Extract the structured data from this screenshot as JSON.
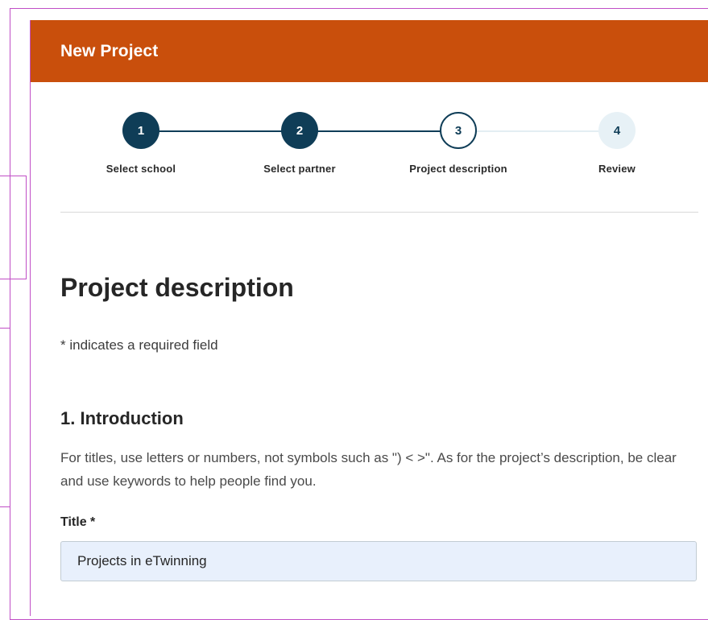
{
  "header": {
    "title": "New Project"
  },
  "stepper": {
    "steps": [
      {
        "number": "1",
        "label": "Select school",
        "state": "done"
      },
      {
        "number": "2",
        "label": "Select partner",
        "state": "done"
      },
      {
        "number": "3",
        "label": "Project description",
        "state": "current"
      },
      {
        "number": "4",
        "label": "Review",
        "state": "pending"
      }
    ]
  },
  "main": {
    "title": "Project description",
    "required_note": "* indicates a required field",
    "section": {
      "title": "1. Introduction",
      "description": "For titles, use letters or numbers, not symbols such as \") < >\".   As for the project’s description, be clear and use keywords to help people find you."
    },
    "title_field": {
      "label": "Title *",
      "value": "Projects in eTwinning"
    }
  },
  "colors": {
    "header_bg": "#c94f0c",
    "step_done": "#0f3d57",
    "step_pending_bg": "#e7f1f6",
    "input_bg": "#e8f0fc"
  }
}
